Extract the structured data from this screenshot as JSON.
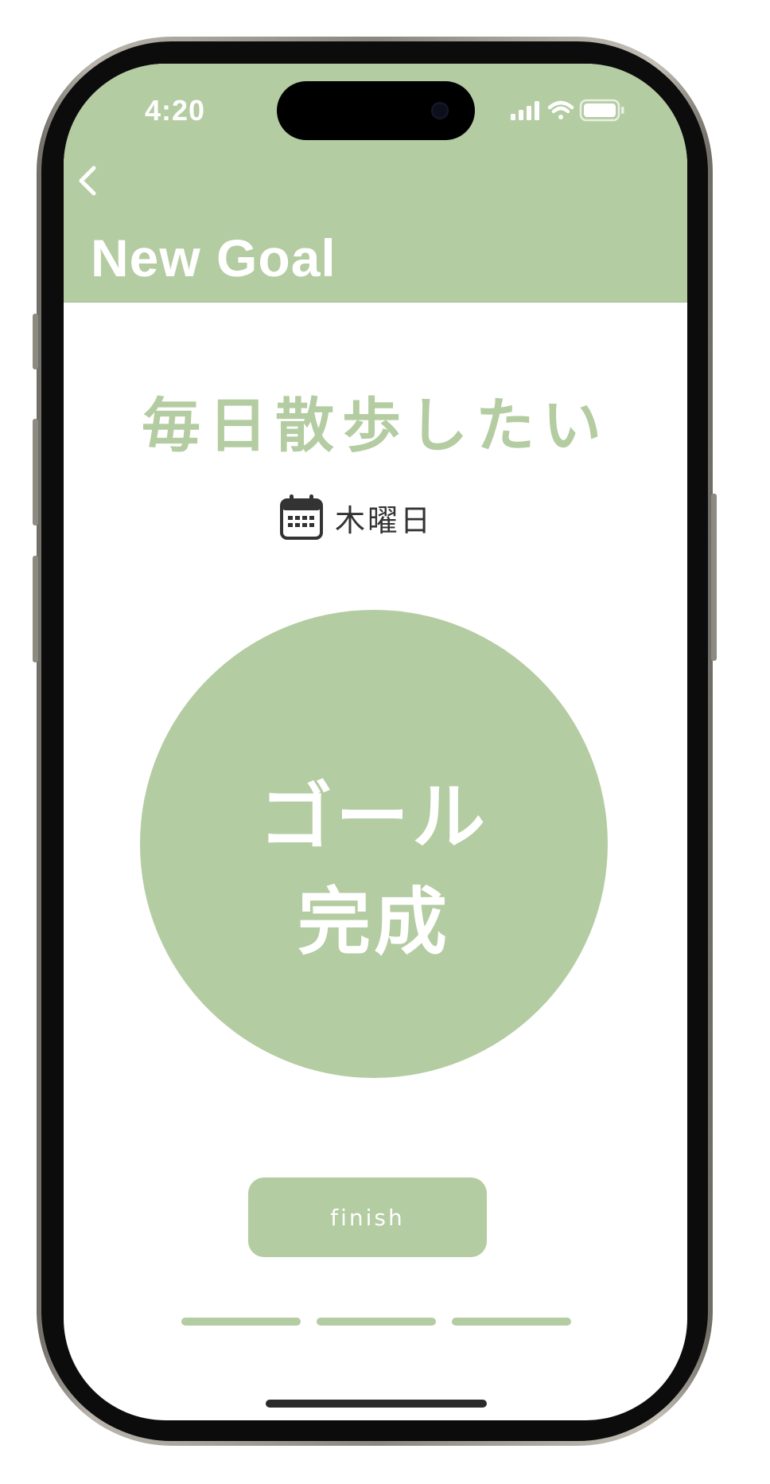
{
  "status_bar": {
    "time": "4:20"
  },
  "nav": {
    "back_icon": "chevron-left-icon",
    "title": "New Goal"
  },
  "goal": {
    "text": "毎日散歩したい",
    "calendar_icon": "calendar-icon",
    "day": "木曜日"
  },
  "complete_button": {
    "line1": "ゴール",
    "line2": "完成"
  },
  "finish_button": {
    "label": "finish"
  },
  "pager": {
    "pages": 3
  },
  "colors": {
    "accent": "#b4cca1",
    "text_dark": "#333333",
    "white": "#ffffff"
  }
}
